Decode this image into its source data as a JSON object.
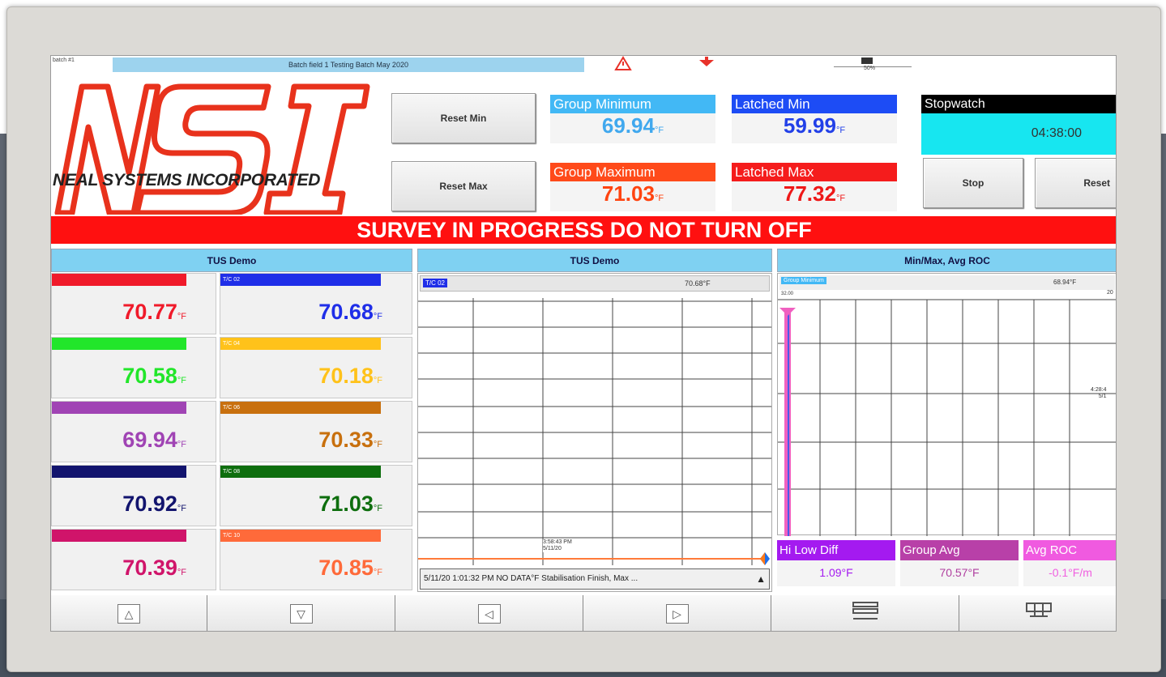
{
  "status_bar": {
    "left_code": "batch #1",
    "batch_text": "Batch field 1 Testing Batch May 2020",
    "alarm_icon": "warning-triangle-icon",
    "alert_icon": "red-alert-icon",
    "storage_label": "50%"
  },
  "logo": {
    "letters": "NSI",
    "company": "NEAL SYSTEMS INCORPORATED",
    "color": "#e8321c"
  },
  "controls": {
    "reset_min": "Reset Min",
    "reset_max": "Reset Max",
    "stop": "Stop",
    "reset": "Reset"
  },
  "tiles": {
    "group_min": {
      "label": "Group Minimum",
      "value": "69.94",
      "unit": "°F",
      "head_color": "#42b8f5",
      "val_color": "#40a8ee"
    },
    "latched_min": {
      "label": "Latched Min",
      "value": "59.99",
      "unit": "°F",
      "head_color": "#1d4cf5",
      "val_color": "#2240e8"
    },
    "group_max": {
      "label": "Group Maximum",
      "value": "71.03",
      "unit": "°F",
      "head_color": "#ff4a1a",
      "val_color": "#ff4410"
    },
    "latched_max": {
      "label": "Latched Max",
      "value": "77.32",
      "unit": "°F",
      "head_color": "#f51c1c",
      "val_color": "#ee1818"
    }
  },
  "stopwatch": {
    "label": "Stopwatch",
    "time": "04:38:00"
  },
  "banner": "SURVEY IN PROGRESS DO NOT TURN OFF",
  "panels": {
    "left_title": "TUS Demo",
    "center_title": "TUS Demo",
    "right_title": "Min/Max, Avg ROC"
  },
  "channels": [
    {
      "tag": "",
      "value": "70.77",
      "unit": "°F",
      "color": "#f01a2a"
    },
    {
      "tag": "T/C 02",
      "value": "70.68",
      "unit": "°F",
      "color": "#1f2ee8"
    },
    {
      "tag": "",
      "value": "70.58",
      "unit": "°F",
      "color": "#22e62a"
    },
    {
      "tag": "T/C 04",
      "value": "70.18",
      "unit": "°F",
      "color": "#ffc21a"
    },
    {
      "tag": "",
      "value": "69.94",
      "unit": "°F",
      "color": "#a044b4"
    },
    {
      "tag": "T/C 06",
      "value": "70.33",
      "unit": "°F",
      "color": "#c8700e"
    },
    {
      "tag": "",
      "value": "70.92",
      "unit": "°F",
      "color": "#12146e"
    },
    {
      "tag": "T/C 08",
      "value": "71.03",
      "unit": "°F",
      "color": "#0e6e0e"
    },
    {
      "tag": "",
      "value": "70.39",
      "unit": "°F",
      "color": "#d0146a"
    },
    {
      "tag": "T/C 10",
      "value": "70.85",
      "unit": "°F",
      "color": "#ff6a3a"
    }
  ],
  "trend": {
    "channel_tag": "T/C 02",
    "channel_value": "70.68°F",
    "time_label": "3:58:43 PM",
    "date_label": "5/11/20",
    "message": "5/11/20 1:01:32 PM NO DATA°F Stabilisation Finish, Max ..."
  },
  "minmax": {
    "channel_tag": "Group Minimum",
    "channel_value": "68.94°F",
    "scale_top": "32.00",
    "scale_right": "20",
    "right_time": "4:28:4",
    "right_date": "5/1"
  },
  "stats": {
    "hi_low": {
      "label": "Hi Low Diff",
      "value": "1.09°F",
      "head_color": "#a41af0",
      "val_color": "#a41af0"
    },
    "group_avg": {
      "label": "Group Avg",
      "value": "70.57°F",
      "head_color": "#b840a8",
      "val_color": "#b040a0"
    },
    "avg_roc": {
      "label": "Avg ROC",
      "value": "-0.1°F/m",
      "head_color": "#f05ae0",
      "val_color": "#f060e0"
    }
  },
  "nav": [
    "up-arrow-icon",
    "down-arrow-icon",
    "left-arrow-icon",
    "right-arrow-icon",
    "menu-icon",
    "grid-icon"
  ]
}
